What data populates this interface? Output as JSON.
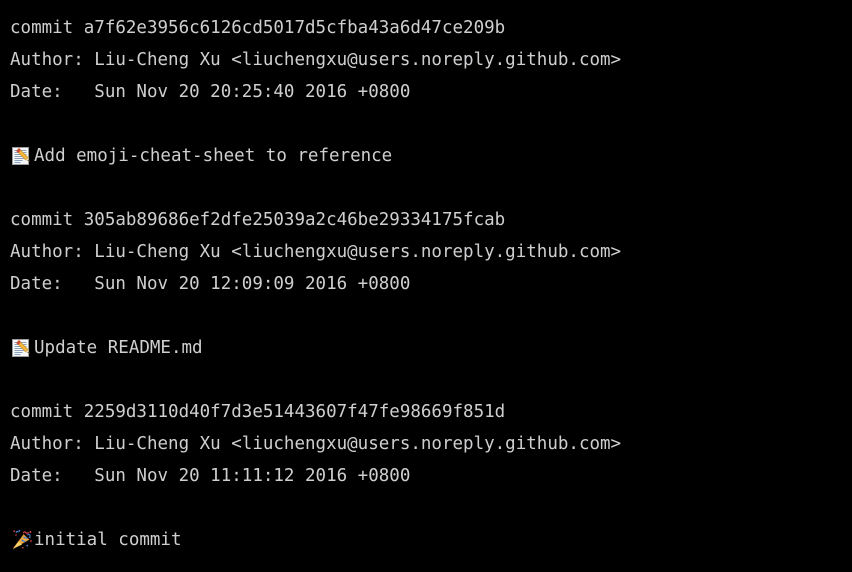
{
  "terminal": {
    "background_color": "#000000",
    "text_color": "#cfcfd1",
    "font_size_px": 17.5,
    "line_height_px": 32
  },
  "log": {
    "commits": [
      {
        "commit_line": "commit a7f62e3956c6126cd5017d5cfba43a6d47ce209b",
        "hash": "a7f62e3956c6126cd5017d5cfba43a6d47ce209b",
        "author_line": "Author: Liu-Cheng Xu <liuchengxu@users.noreply.github.com>",
        "author_name": "Liu-Cheng Xu",
        "author_email": "liuchengxu@users.noreply.github.com",
        "date_line": "Date:   Sun Nov 20 20:25:40 2016 +0800",
        "date": "Sun Nov 20 20:25:40 2016 +0800",
        "emoji": "memo-icon",
        "emoji_char": "📝",
        "message": "Add emoji-cheat-sheet to reference"
      },
      {
        "commit_line": "commit 305ab89686ef2dfe25039a2c46be29334175fcab",
        "hash": "305ab89686ef2dfe25039a2c46be29334175fcab",
        "author_line": "Author: Liu-Cheng Xu <liuchengxu@users.noreply.github.com>",
        "author_name": "Liu-Cheng Xu",
        "author_email": "liuchengxu@users.noreply.github.com",
        "date_line": "Date:   Sun Nov 20 12:09:09 2016 +0800",
        "date": "Sun Nov 20 12:09:09 2016 +0800",
        "emoji": "memo-icon",
        "emoji_char": "📝",
        "message": "Update README.md"
      },
      {
        "commit_line": "commit 2259d3110d40f7d3e51443607f47fe98669f851d",
        "hash": "2259d3110d40f7d3e51443607f47fe98669f851d",
        "author_line": "Author: Liu-Cheng Xu <liuchengxu@users.noreply.github.com>",
        "author_name": "Liu-Cheng Xu",
        "author_email": "liuchengxu@users.noreply.github.com",
        "date_line": "Date:   Sun Nov 20 11:11:12 2016 +0800",
        "date": "Sun Nov 20 11:11:12 2016 +0800",
        "emoji": "party-popper-icon",
        "emoji_char": "🎉",
        "message": "initial commit"
      }
    ]
  }
}
